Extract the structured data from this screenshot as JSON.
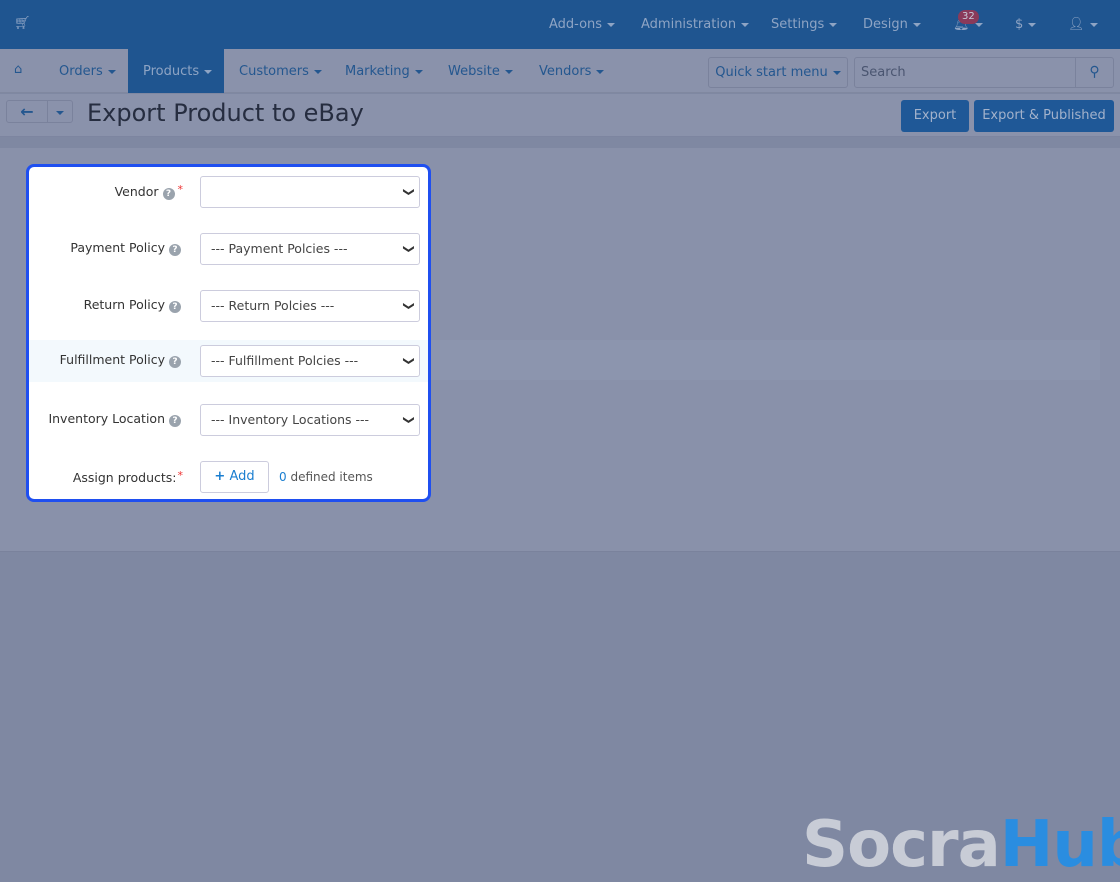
{
  "topbar": {
    "items": [
      "Add-ons",
      "Administration",
      "Settings",
      "Design"
    ],
    "notifications": "32",
    "currency": "$"
  },
  "nav": {
    "items": [
      "Orders",
      "Products",
      "Customers",
      "Marketing",
      "Website",
      "Vendors"
    ],
    "active": "Products",
    "quick_start": "Quick start menu",
    "search_placeholder": "Search"
  },
  "page": {
    "title": "Export Product to eBay",
    "export": "Export",
    "export_published": "Export & Published"
  },
  "form": {
    "vendor": {
      "label": "Vendor",
      "value": ""
    },
    "payment": {
      "label": "Payment Policy",
      "value": "--- Payment Polcies ---"
    },
    "return": {
      "label": "Return Policy",
      "value": "--- Return Polcies ---"
    },
    "fulfillment": {
      "label": "Fulfillment Policy",
      "value": "--- Fulfillment Polcies ---"
    },
    "inventory": {
      "label": "Inventory Location",
      "value": "--- Inventory Locations ---"
    },
    "assign": {
      "label": "Assign products:",
      "add": "Add",
      "count": "0",
      "count_suffix": " defined items"
    }
  },
  "watermark": {
    "part1": "Socra",
    "part2": "Hub"
  },
  "colors": {
    "accent": "#1f4ff0",
    "topbar": "#1f5590"
  }
}
